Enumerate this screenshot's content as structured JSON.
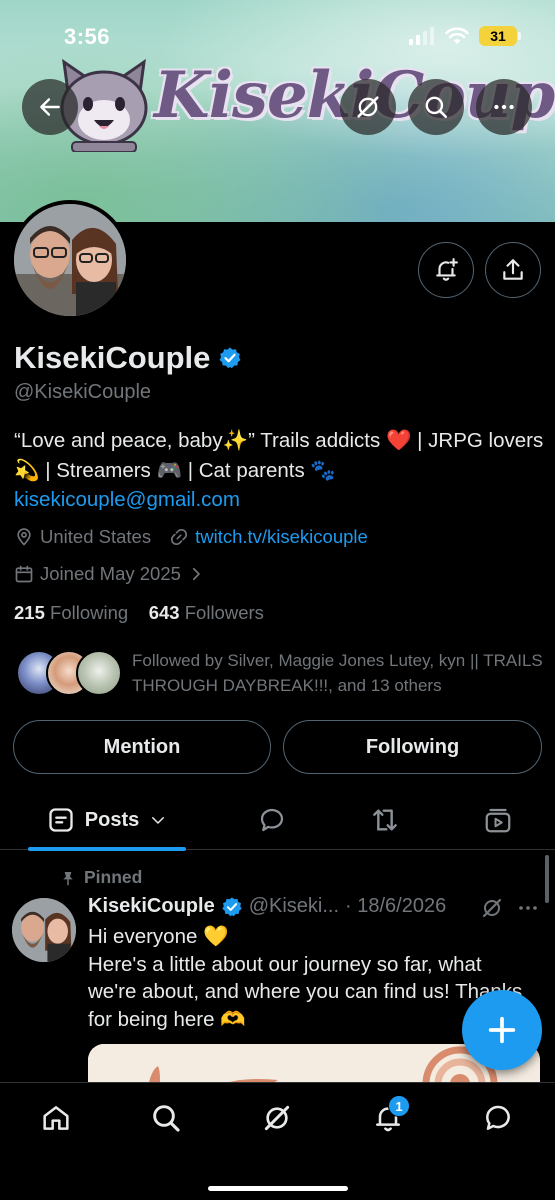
{
  "status_bar": {
    "time": "3:56",
    "battery": "31"
  },
  "banner": {
    "logo_text": "KisekiCouple"
  },
  "profile": {
    "display_name": "KisekiCouple",
    "handle": "@KisekiCouple",
    "bio_line": "“Love and peace, baby✨” Trails addicts ❤️ | JRPG lovers 💫 | Streamers 🎮 | Cat parents 🐾",
    "email": "kisekicouple@gmail.com",
    "location": "United States",
    "website": "twitch.tv/kisekicouple",
    "joined": "Joined May 2025",
    "following_count": "215",
    "following_label": "Following",
    "followers_count": "643",
    "followers_label": "Followers",
    "followed_by": "Followed by Silver, Maggie Jones Lutey, kyn || TRAILS THROUGH DAYBREAK!!!, and 13 others"
  },
  "actions": {
    "mention": "Mention",
    "following": "Following"
  },
  "tabs": {
    "posts": "Posts"
  },
  "post": {
    "pinned_label": "Pinned",
    "author": "KisekiCouple",
    "handle": "@Kiseki...",
    "date": "· 18/6/2026",
    "line1": "Hi everyone 💛",
    "line2": "Here's a little about our journey so far, what we're about, and where you can find us! Thanks for being here 🫶"
  },
  "nav": {
    "notifications_badge": "1"
  },
  "colors": {
    "accent": "#1d9bf0",
    "muted": "#71767b",
    "text": "#e7e9ea",
    "border": "#2f3336"
  },
  "icons": [
    "back-arrow-icon",
    "grok-icon",
    "search-icon",
    "more-icon",
    "notification-add-icon",
    "share-icon",
    "verified-icon",
    "location-icon",
    "link-icon",
    "calendar-icon",
    "chevron-right-icon",
    "posts-icon",
    "chevron-down-icon",
    "replies-icon",
    "reposts-icon",
    "media-icon",
    "pin-icon",
    "plus-icon",
    "home-icon",
    "bell-icon",
    "messages-icon"
  ]
}
